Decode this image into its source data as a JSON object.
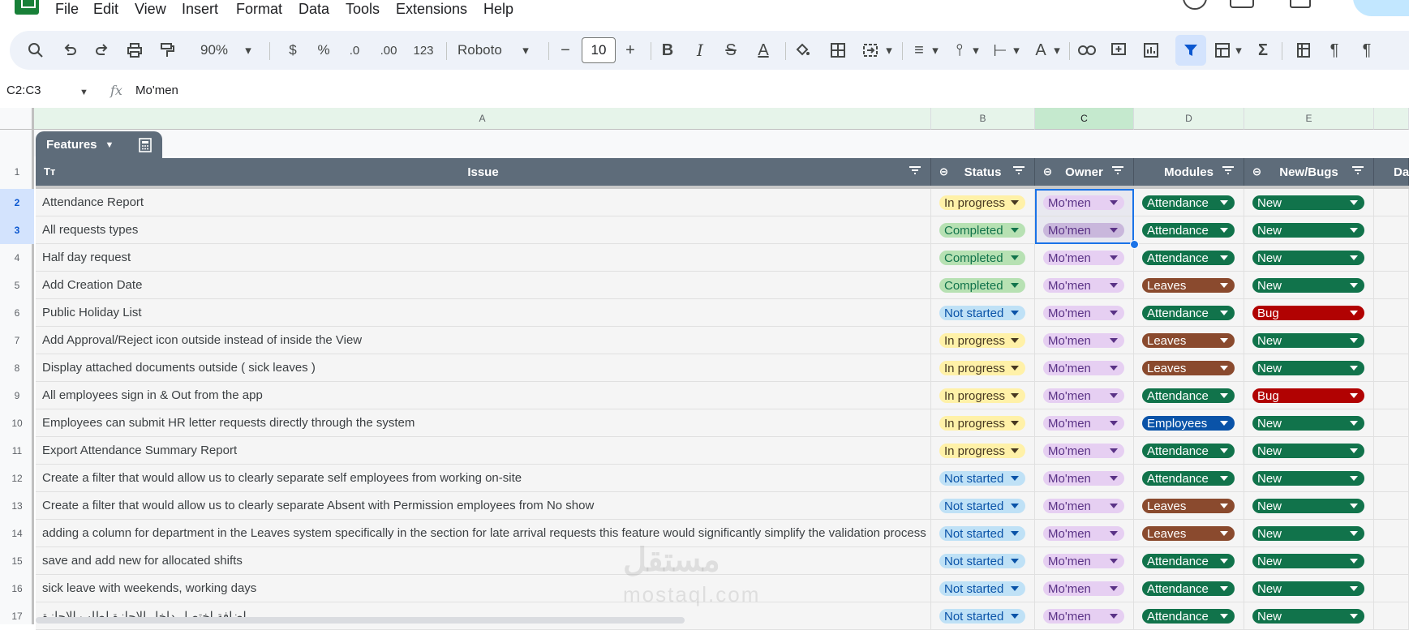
{
  "menu": [
    "File",
    "Edit",
    "View",
    "Insert",
    "Format",
    "Data",
    "Tools",
    "Extensions",
    "Help"
  ],
  "toolbar": {
    "zoom": "90%",
    "currency": "$",
    "percent": "%",
    "dec_decrease": ".0",
    "dec_increase": ".00",
    "number_format": "123",
    "font": "Roboto",
    "font_size": "10"
  },
  "formula_bar": {
    "name_box": "C2:C3",
    "fx": "fx",
    "value": "Mo'men"
  },
  "column_headers": [
    "A",
    "B",
    "C",
    "D",
    "E",
    ""
  ],
  "table": {
    "name": "Features",
    "headers": {
      "issue": "Issue",
      "status": "Status",
      "owner": "Owner",
      "modules": "Modules",
      "newbugs": "New/Bugs",
      "date": "Da"
    },
    "header_row_num": "1",
    "rows": [
      {
        "n": "2",
        "issue": "Attendance Report",
        "status": "In progress",
        "owner": "Mo'men",
        "module": "Attendance",
        "type": "New"
      },
      {
        "n": "3",
        "issue": "All requests types",
        "status": "Completed",
        "owner": "Mo'men",
        "module": "Attendance",
        "type": "New"
      },
      {
        "n": "4",
        "issue": "Half day request",
        "status": "Completed",
        "owner": "Mo'men",
        "module": "Attendance",
        "type": "New"
      },
      {
        "n": "5",
        "issue": "Add Creation Date",
        "status": "Completed",
        "owner": "Mo'men",
        "module": "Leaves",
        "type": "New"
      },
      {
        "n": "6",
        "issue": "Public Holiday List",
        "status": "Not started",
        "owner": "Mo'men",
        "module": "Attendance",
        "type": "Bug"
      },
      {
        "n": "7",
        "issue": "Add Approval/Reject icon outside instead of inside the View",
        "status": "In progress",
        "owner": "Mo'men",
        "module": "Leaves",
        "type": "New"
      },
      {
        "n": "8",
        "issue": "Display attached documents outside ( sick leaves )",
        "status": "In progress",
        "owner": "Mo'men",
        "module": "Leaves",
        "type": "New"
      },
      {
        "n": "9",
        "issue": "All employees sign in & Out from the app",
        "status": "In progress",
        "owner": "Mo'men",
        "module": "Attendance",
        "type": "Bug"
      },
      {
        "n": "10",
        "issue": "Employees can submit HR letter requests directly through the system",
        "status": "In progress",
        "owner": "Mo'men",
        "module": "Employees",
        "type": "New"
      },
      {
        "n": "11",
        "issue": "Export Attendance Summary Report",
        "status": "In progress",
        "owner": "Mo'men",
        "module": "Attendance",
        "type": "New"
      },
      {
        "n": "12",
        "issue": "Create a filter that would allow us to clearly separate self employees from working on-site",
        "status": "Not started",
        "owner": "Mo'men",
        "module": "Attendance",
        "type": "New"
      },
      {
        "n": "13",
        "issue": "Create a filter that would allow us to clearly separate Absent with Permission employees from No show",
        "status": "Not started",
        "owner": "Mo'men",
        "module": "Leaves",
        "type": "New"
      },
      {
        "n": "14",
        "issue": "adding a column for department in the Leaves system specifically in the section for late arrival requests this feature would significantly simplify the validation process",
        "status": "Not started",
        "owner": "Mo'men",
        "module": "Leaves",
        "type": "New"
      },
      {
        "n": "15",
        "issue": "save and add new for allocated shifts",
        "status": "Not started",
        "owner": "Mo'men",
        "module": "Attendance",
        "type": "New"
      },
      {
        "n": "16",
        "issue": "sick leave with weekends, working days",
        "status": "Not started",
        "owner": "Mo'men",
        "module": "Attendance",
        "type": "New"
      },
      {
        "n": "17",
        "issue": "إضافة اختصار داخل الإجازة لطلب الإجازة",
        "status": "Not started",
        "owner": "Mo'men",
        "module": "Attendance",
        "type": "New"
      }
    ]
  },
  "chip_colors": {
    "status": {
      "In progress": {
        "bg": "#fff1a8",
        "fg": "#473821",
        "dd": "#473821"
      },
      "Completed": {
        "bg": "#b7e1b3",
        "fg": "#11734b",
        "dd": "#11734b"
      },
      "Not started": {
        "bg": "#bfe1f6",
        "fg": "#0a53a8",
        "dd": "#0a53a8"
      }
    },
    "owner": {
      "bg": "#e6cff2",
      "fg": "#5a3286",
      "dd": "#5a3286"
    },
    "module": {
      "Attendance": {
        "bg": "#11734b",
        "fg": "#ffffff",
        "dd": "#ffffff"
      },
      "Leaves": {
        "bg": "#8a4a2e",
        "fg": "#ffffff",
        "dd": "#ffffff"
      },
      "Employees": {
        "bg": "#0a53a8",
        "fg": "#ffffff",
        "dd": "#ffffff"
      }
    },
    "type": {
      "New": {
        "bg": "#11734b",
        "fg": "#ffffff",
        "dd": "#ffffff"
      },
      "Bug": {
        "bg": "#b10202",
        "fg": "#ffffff",
        "dd": "#ffffff"
      }
    }
  },
  "watermark": {
    "arabic": "مستقل",
    "latin": "mostaql.com"
  }
}
